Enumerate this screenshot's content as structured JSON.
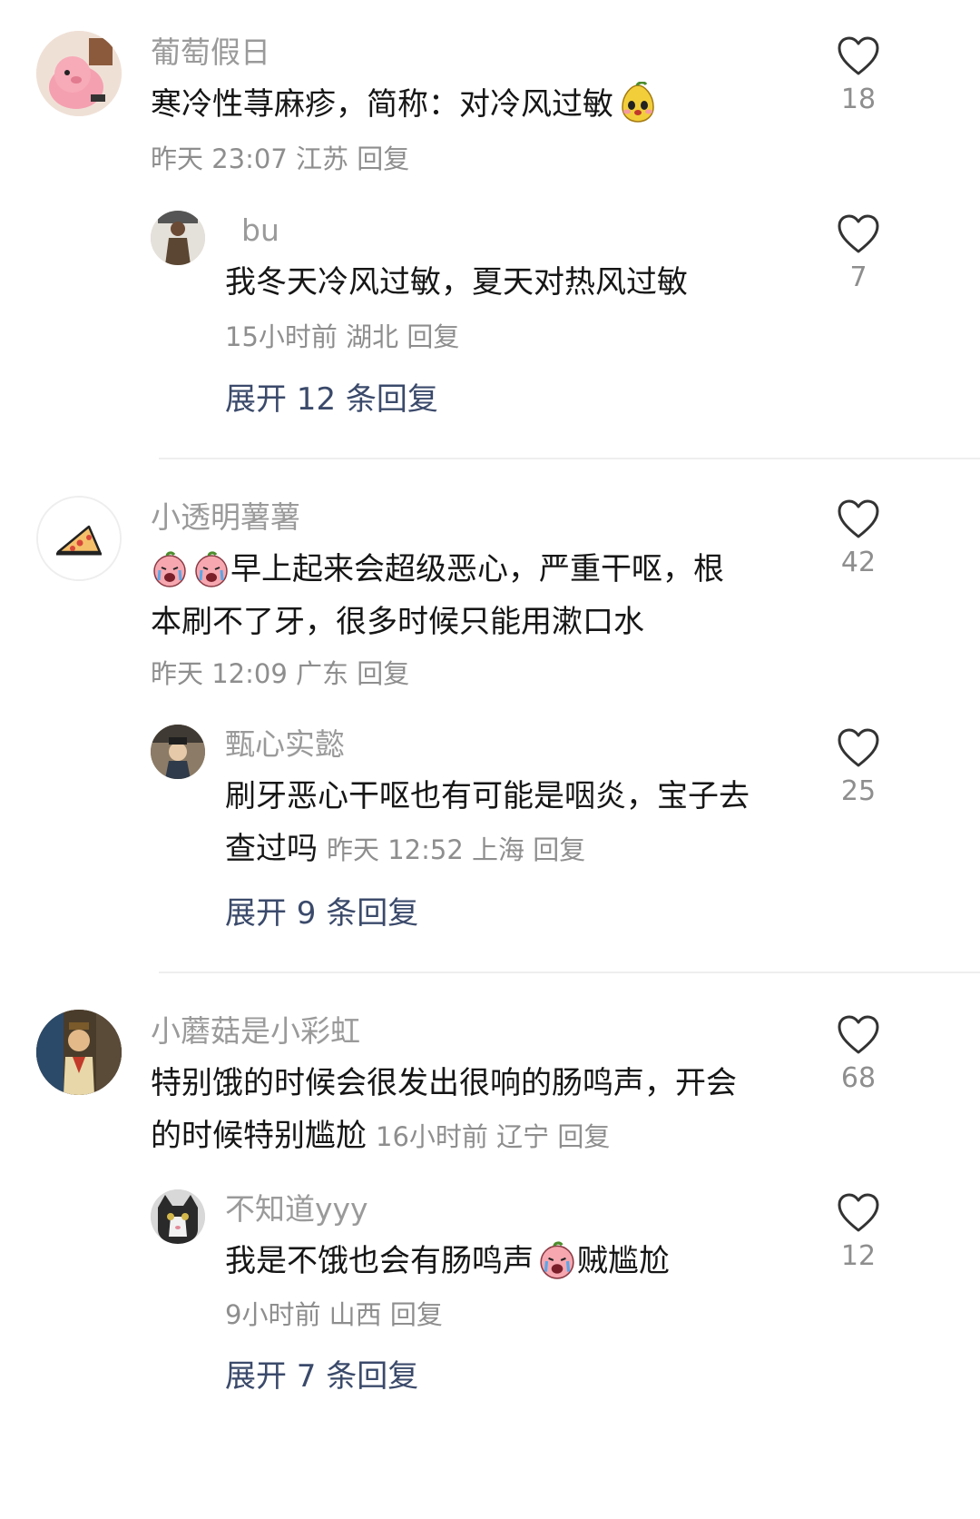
{
  "comments": [
    {
      "username": "葡萄假日",
      "text": "寒冷性荨麻疹，简称：对冷风过敏",
      "emoji": "pear-face-emoji",
      "time": "昨天 23:07",
      "location": "江苏",
      "reply_label": "回复",
      "likes": "18",
      "reply": {
        "username": "bu",
        "text": "我冬天冷风过敏，夏天对热风过敏",
        "time": "15小时前",
        "location": "湖北",
        "reply_label": "回复",
        "likes": "7"
      },
      "expand_label": "展开 12 条回复"
    },
    {
      "username": "小透明薯薯",
      "text_line1": "早上起来会超级恶心，严重干呕，根",
      "text_line2": "本刷不了牙，很多时候只能用漱口水",
      "emoji": "crying-face-emoji",
      "time": "昨天 12:09",
      "location": "广东",
      "reply_label": "回复",
      "likes": "42",
      "reply": {
        "username": "甄心实懿",
        "text_line1": "刷牙恶心干呕也有可能是咽炎，宝子去",
        "text_line2": "查过吗",
        "time": "昨天 12:52",
        "location": "上海",
        "reply_label": "回复",
        "likes": "25"
      },
      "expand_label": "展开 9 条回复"
    },
    {
      "username": "小蘑菇是小彩虹",
      "text_line1": "特别饿的时候会很发出很响的肠鸣声，开会",
      "text_line2": "的时候特别尴尬",
      "time": "16小时前",
      "location": "辽宁",
      "reply_label": "回复",
      "likes": "68",
      "reply": {
        "username": "不知道yyy",
        "text_before": "我是不饿也会有肠鸣声",
        "emoji": "crying-face-emoji",
        "text_after": "贼尴尬",
        "time": "9小时前",
        "location": "山西",
        "reply_label": "回复",
        "likes": "12"
      },
      "expand_label": "展开 7 条回复"
    }
  ],
  "colors": {
    "meta_gray": "#8e8e8e",
    "username_gray": "#9a9a9a",
    "expand_blue": "#3b4a6b",
    "divider": "#eeeeee"
  }
}
